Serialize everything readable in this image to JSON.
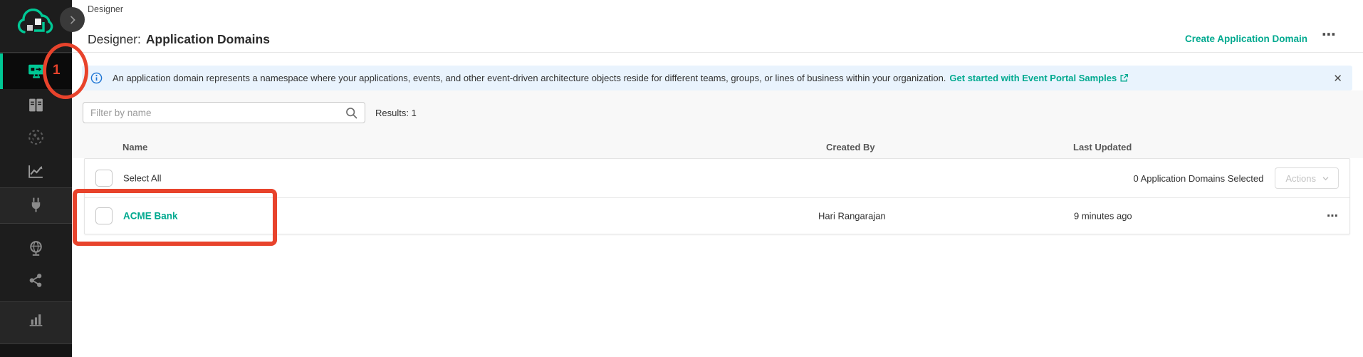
{
  "colors": {
    "accent_teal": "#00a98f",
    "logo_teal": "#00c895",
    "annotation_red": "#e8432c",
    "banner_bg": "#e9f3fd",
    "info_blue": "#1c74d4",
    "sidebar_bg": "#1d1d1d"
  },
  "sidebar": {
    "designer_badge": "1",
    "items": [
      {
        "icon": "designer-icon",
        "active": true
      },
      {
        "icon": "catalog-icon"
      },
      {
        "icon": "event-mesh-icon"
      },
      {
        "icon": "insights-icon"
      },
      {
        "icon": "plug-icon"
      },
      {
        "icon": "runtime-globe-icon"
      },
      {
        "icon": "share-icon"
      },
      {
        "icon": "bar-chart-icon"
      }
    ]
  },
  "header": {
    "breadcrumb": "Designer",
    "title_prefix": "Designer:",
    "title": "Application Domains",
    "create_button": "Create Application Domain",
    "more": "⋯"
  },
  "banner": {
    "message": "An application domain represents a namespace where your applications, events, and other event-driven architecture objects reside for different teams, groups, or lines of business within your organization.",
    "link": "Get started with Event Portal Samples",
    "close": "✕"
  },
  "filter": {
    "placeholder": "Filter by name",
    "results": "Results: 1"
  },
  "table": {
    "columns": {
      "name": "Name",
      "created_by": "Created By",
      "last_updated": "Last Updated"
    },
    "select_all": "Select All",
    "selection_status": "0 Application Domains Selected",
    "actions_button": "Actions",
    "rows": [
      {
        "name": "ACME Bank",
        "created_by": "Hari Rangarajan",
        "last_updated": "9 minutes ago",
        "more": "⋯"
      }
    ]
  }
}
